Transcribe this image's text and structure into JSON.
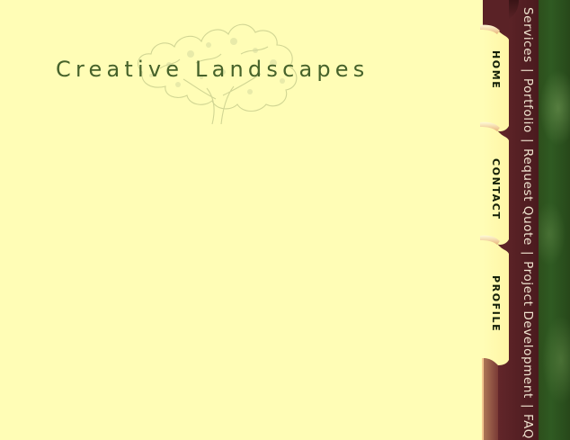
{
  "site": {
    "title": "Creative Landscapes"
  },
  "tabs": [
    {
      "label": "HOME"
    },
    {
      "label": "CONTACT"
    },
    {
      "label": "PROFILE"
    }
  ],
  "nav": {
    "separator": "|",
    "items": [
      {
        "label": "Services"
      },
      {
        "label": "Portfolio"
      },
      {
        "label": "Request Quote"
      },
      {
        "label": "Project Development"
      },
      {
        "label": "FAQ"
      }
    ]
  },
  "colors": {
    "background": "#fffdb6",
    "title": "#46622a",
    "maroon": "#5a2226",
    "green": "#2d4f1c",
    "tab_highlight": "#f4c890"
  },
  "icons": {
    "logo": "oak-tree-icon"
  }
}
